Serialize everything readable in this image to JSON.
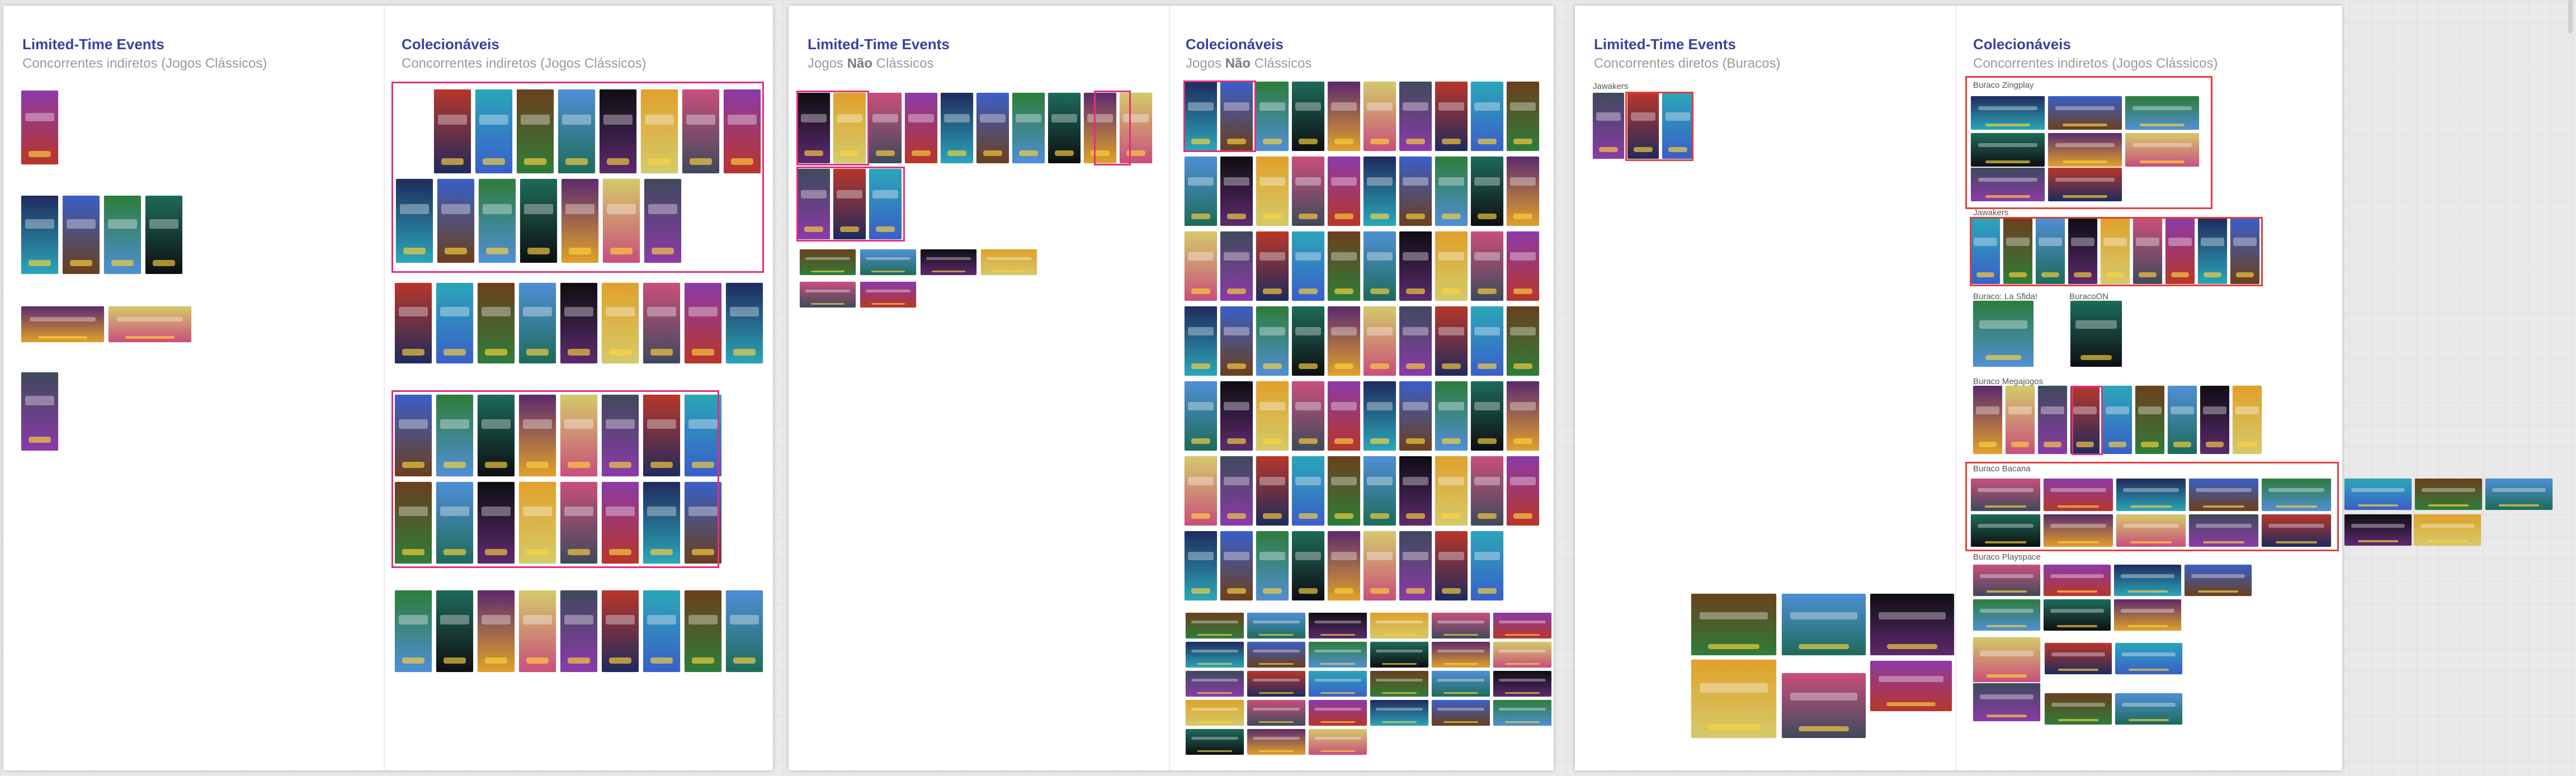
{
  "colors": {
    "title": "#3a3fa3",
    "subtitle": "#9a9a9a",
    "highlight_pink": "#e0307d",
    "highlight_red": "#e43d3d"
  },
  "boards": [
    {
      "left": {
        "title": "Limited-Time Events",
        "subtitle": "Concorrentes indiretos (Jogos Clássicos)"
      },
      "right": {
        "title": "Colecionáveis",
        "subtitle": "Concorrentes indiretos (Jogos Clássicos)"
      }
    },
    {
      "left": {
        "title": "Limited-Time Events",
        "subtitle_pre": "Jogos ",
        "subtitle_bold": "Não",
        "subtitle_post": " Clássicos"
      },
      "right": {
        "title": "Colecionáveis",
        "subtitle_pre": "Jogos ",
        "subtitle_bold": "Não",
        "subtitle_post": " Clássicos"
      }
    },
    {
      "left": {
        "title": "Limited-Time Events",
        "subtitle": "Concorrentes diretos (Buracos)",
        "group_labels": [
          "Jawakers"
        ]
      },
      "right": {
        "title": "Colecionáveis",
        "subtitle": "Concorrentes indiretos (Jogos Clássicos)",
        "group_labels": [
          "Buraco Zingplay",
          "Jawakers",
          "Buraco: La Sfida!",
          "BuracoON",
          "Buraco Megajogos",
          "Buraco Bacana",
          "Buraco Playspace"
        ]
      }
    }
  ]
}
